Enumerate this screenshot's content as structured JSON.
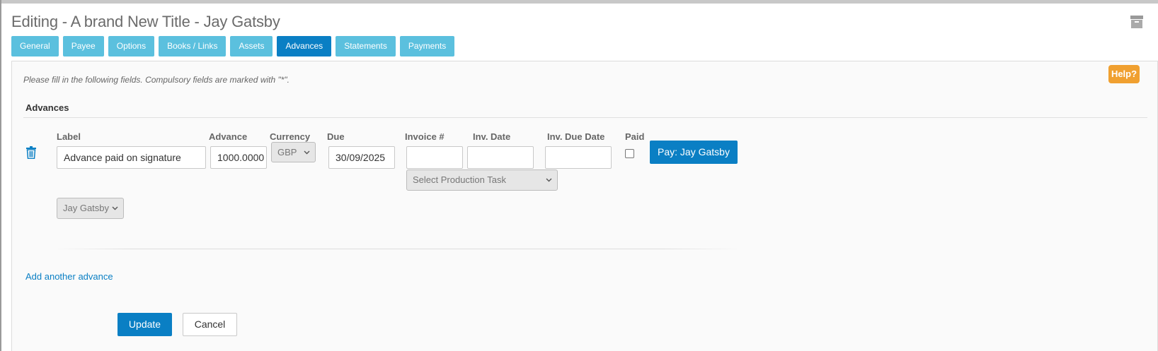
{
  "header": {
    "title": "Editing - A brand New Title - Jay Gatsby",
    "archive_icon": "archive-box-icon"
  },
  "tabs": [
    {
      "label": "General"
    },
    {
      "label": "Payee"
    },
    {
      "label": "Options"
    },
    {
      "label": "Books / Links"
    },
    {
      "label": "Assets"
    },
    {
      "label": "Advances",
      "active": true
    },
    {
      "label": "Statements"
    },
    {
      "label": "Payments"
    }
  ],
  "form": {
    "intro": "Please fill in the following fields. Compulsory fields are marked with \"*\".",
    "help_label": "Help?",
    "section_title": "Advances",
    "columns": {
      "label": "Label",
      "advance": "Advance",
      "currency": "Currency",
      "due": "Due",
      "invoice": "Invoice #",
      "inv_date": "Inv. Date",
      "inv_due_date": "Inv. Due Date",
      "paid": "Paid"
    },
    "row": {
      "label_value": "Advance paid on signature",
      "advance_value": "1000.0000",
      "currency_value": "GBP",
      "due_value": "30/09/2025",
      "invoice_value": "",
      "inv_date_value": "",
      "inv_due_date_value": "",
      "paid_checked": false,
      "pay_button": "Pay: Jay Gatsby",
      "production_task_placeholder": "Select Production Task",
      "payee_value": "Jay Gatsby"
    },
    "add_another": "Add another advance",
    "update_label": "Update",
    "cancel_label": "Cancel"
  },
  "colors": {
    "tab": "#5bc0de",
    "tab_active": "#0a7fc4",
    "primary": "#0a7fc4",
    "help": "#f0a030"
  }
}
